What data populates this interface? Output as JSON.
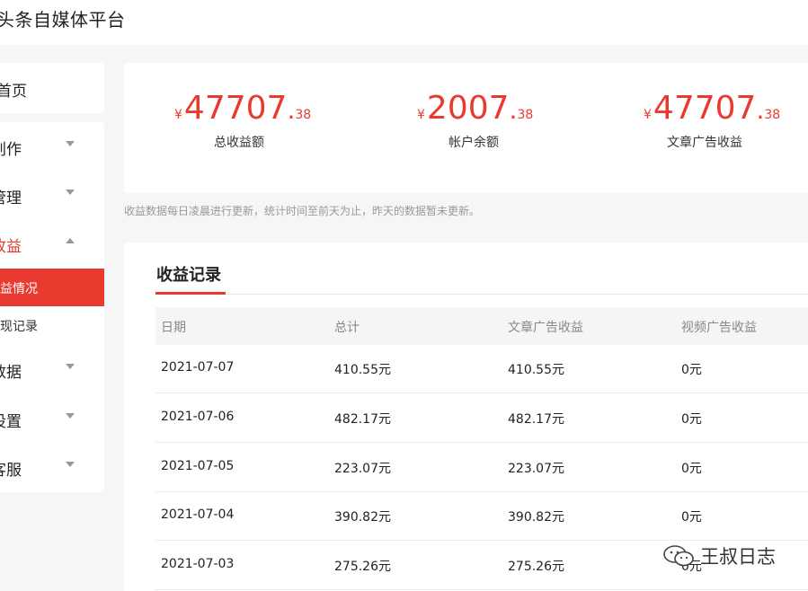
{
  "header": {
    "title": "头条自媒体平台"
  },
  "sidebar": {
    "home_label": "首页",
    "items": [
      {
        "label": "创作"
      },
      {
        "label": "管理"
      },
      {
        "label": "收益"
      },
      {
        "label": "数据"
      },
      {
        "label": "设置"
      },
      {
        "label": "客服"
      }
    ],
    "sub_items": [
      {
        "label": "收益情况"
      },
      {
        "label": "提现记录"
      }
    ]
  },
  "stats": [
    {
      "currency": "¥",
      "integer": "47707",
      "decimal": "38",
      "caption": "总收益额"
    },
    {
      "currency": "¥",
      "integer": "2007",
      "decimal": "38",
      "caption": "帐户余额"
    },
    {
      "currency": "¥",
      "integer": "47707",
      "decimal": "38",
      "caption": "文章广告收益"
    }
  ],
  "note": "收益数据每日凌晨进行更新，统计时间至前天为止，昨天的数据暂未更新。",
  "records": {
    "title": "收益记录",
    "columns": [
      "日期",
      "总计",
      "文章广告收益",
      "视频广告收益"
    ],
    "rows": [
      [
        "2021-07-07",
        "410.55元",
        "410.55元",
        "0元"
      ],
      [
        "2021-07-06",
        "482.17元",
        "482.17元",
        "0元"
      ],
      [
        "2021-07-05",
        "223.07元",
        "223.07元",
        "0元"
      ],
      [
        "2021-07-04",
        "390.82元",
        "390.82元",
        "0元"
      ],
      [
        "2021-07-03",
        "275.26元",
        "275.26元",
        "0元"
      ]
    ]
  },
  "watermark": {
    "text": "王叔日志"
  },
  "colors": {
    "accent": "#e83a2f",
    "background": "#f6f6f6",
    "muted": "#999999"
  }
}
